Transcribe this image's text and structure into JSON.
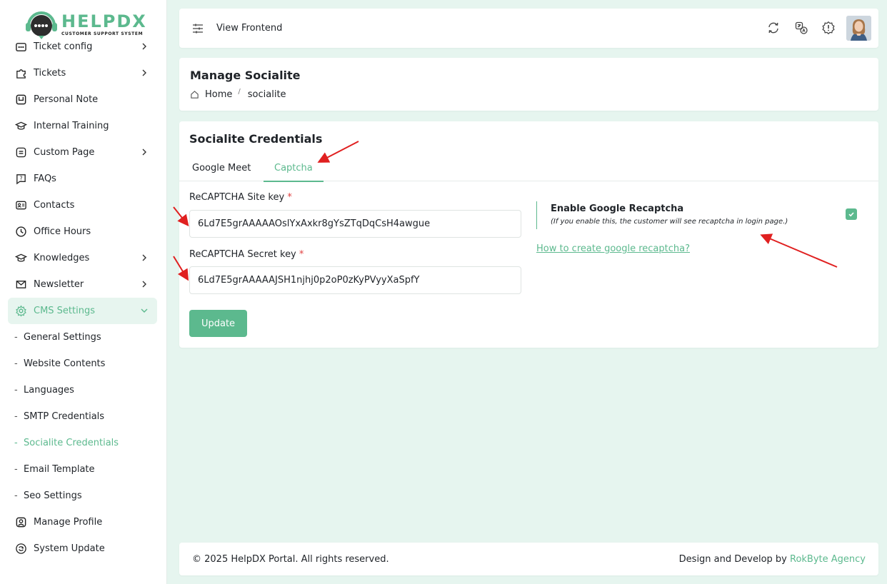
{
  "brand": {
    "name": "HELPDX",
    "tagline": "CUSTOMER SUPPORT SYSTEM"
  },
  "sidebar": {
    "items": [
      {
        "label": "Ticket config",
        "icon": "ticket-config-icon"
      },
      {
        "label": "Tickets",
        "icon": "puzzle-icon"
      },
      {
        "label": "Personal Note",
        "icon": "note-icon"
      },
      {
        "label": "Internal Training",
        "icon": "graduation-icon"
      },
      {
        "label": "Custom Page",
        "icon": "page-icon"
      },
      {
        "label": "FAQs",
        "icon": "question-icon"
      },
      {
        "label": "Contacts",
        "icon": "contact-card-icon"
      },
      {
        "label": "Office Hours",
        "icon": "clock-icon"
      },
      {
        "label": "Knowledges",
        "icon": "graduation-icon"
      },
      {
        "label": "Newsletter",
        "icon": "mail-icon"
      },
      {
        "label": "CMS Settings",
        "icon": "gear-icon"
      }
    ],
    "sub_items": [
      {
        "label": "General Settings"
      },
      {
        "label": "Website Contents"
      },
      {
        "label": "Languages"
      },
      {
        "label": "SMTP Credentials"
      },
      {
        "label": "Socialite Credentials"
      },
      {
        "label": "Email Template"
      },
      {
        "label": "Seo Settings"
      }
    ],
    "bottom_items": [
      {
        "label": "Manage Profile",
        "icon": "user-icon"
      },
      {
        "label": "System Update",
        "icon": "refresh-icon"
      }
    ]
  },
  "topbar": {
    "view_frontend": "View Frontend",
    "icons": [
      "sync-icon",
      "translate-icon",
      "alert-icon"
    ]
  },
  "header": {
    "title": "Manage Socialite",
    "breadcrumb": [
      "Home",
      "socialite"
    ]
  },
  "main": {
    "title": "Socialite Credentials",
    "tabs": [
      {
        "label": "Google Meet",
        "active": false
      },
      {
        "label": "Captcha",
        "active": true
      }
    ],
    "site_key": {
      "label": "ReCAPTCHA Site key",
      "required": "*",
      "value": "6Ld7E5grAAAAAOslYxAxkr8gYsZTqDqCsH4awgue"
    },
    "secret_key": {
      "label": "ReCAPTCHA Secret key",
      "required": "*",
      "value": "6Ld7E5grAAAAAJSH1njhj0p2oP0zKyPVyyXaSpfY"
    },
    "update_label": "Update",
    "recaptcha": {
      "title": "Enable Google Recaptcha",
      "note": "(If you enable this, the customer will see recaptcha in login page.)",
      "enabled": true,
      "link": "How to create google recaptcha?"
    }
  },
  "footer": {
    "copyright": "© 2025 HelpDX Portal. All rights reserved.",
    "credit_prefix": "Design and Develop by ",
    "agency": "RokByte Agency"
  },
  "colors": {
    "accent": "#5cb98e",
    "background": "#e6f5ef",
    "annotation": "#e02020"
  }
}
